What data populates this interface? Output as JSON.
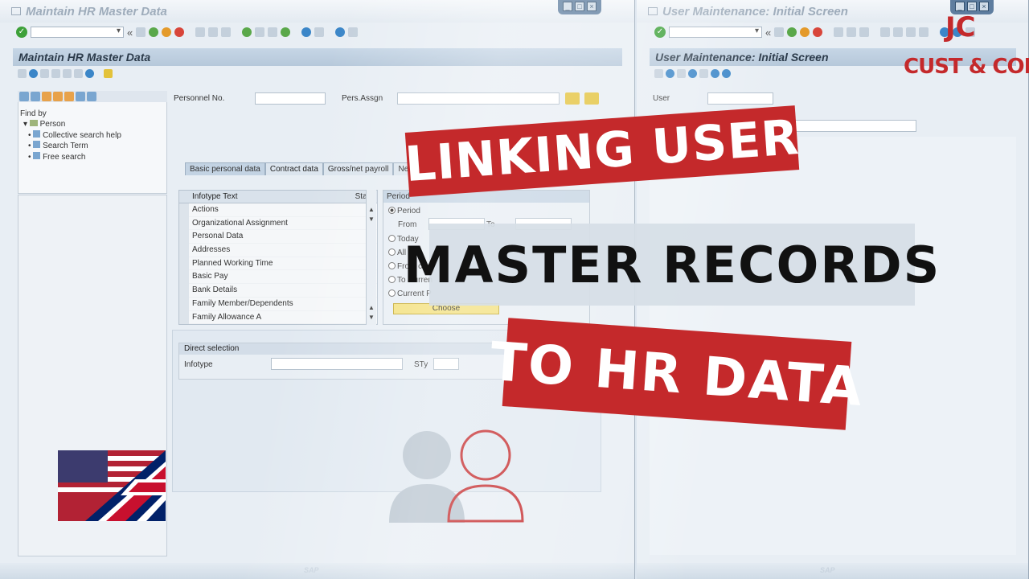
{
  "left_window": {
    "title": "Maintain HR Master Data",
    "screen_title": "Maintain HR Master Data",
    "fields": {
      "personnel_no_label": "Personnel No.",
      "pers_assgn_label": "Pers.Assgn"
    },
    "find_by": {
      "label": "Find by",
      "root": "Person",
      "items": [
        "Collective search help",
        "Search Term",
        "Free search"
      ]
    },
    "tabs": [
      "Basic personal data",
      "Contract data",
      "Gross/net payroll",
      "Net p"
    ],
    "infotype_table": {
      "col_text": "Infotype Text",
      "col_status": "Sta...",
      "rows": [
        "Actions",
        "Organizational Assignment",
        "Personal Data",
        "Addresses",
        "Planned Working Time",
        "Basic Pay",
        "Bank Details",
        "Family Member/Dependents",
        "Family Allowance  A"
      ]
    },
    "period": {
      "header": "Period",
      "options": [
        "Period",
        "Today",
        "All",
        "From curr",
        "To Curren",
        "Current P"
      ],
      "from_label": "From",
      "to_label": "To",
      "choose_label": "Choose"
    },
    "direct_selection": {
      "header": "Direct selection",
      "infotype_label": "Infotype",
      "sty_label": "STy"
    }
  },
  "right_window": {
    "title": "User Maintenance: Initial Screen",
    "screen_title": "User Maintenance: Initial Screen",
    "user_label": "User"
  },
  "overlay": {
    "line1": "LINKING USER",
    "line2": "MASTER RECORDS",
    "line3": "TO HR DATA",
    "logo_mark": "JC",
    "logo_text": "CUST & CODE"
  },
  "colors": {
    "banner_red": "#c4292b",
    "banner_gray": "#d6dee6"
  }
}
